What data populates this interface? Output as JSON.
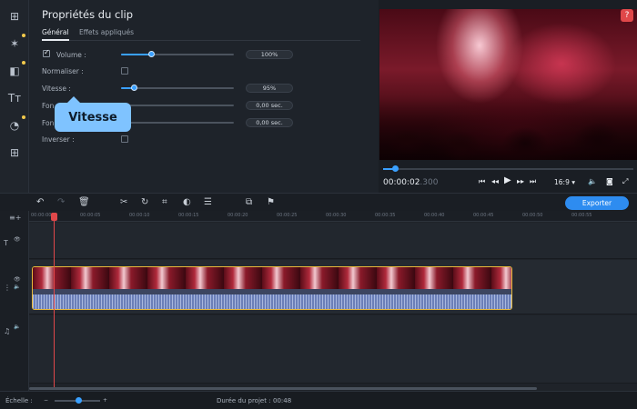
{
  "properties": {
    "title": "Propriétés du clip",
    "tabs": [
      {
        "label": "Général",
        "active": true
      },
      {
        "label": "Effets appliqués",
        "active": false
      }
    ],
    "rows": {
      "volume": {
        "label": "Volume :",
        "checked": true,
        "value": "100%",
        "level": 0.33
      },
      "normaliser": {
        "label": "Normaliser :",
        "checked": false
      },
      "vitesse": {
        "label": "Vitesse :",
        "value": "95%",
        "level": 0.1
      },
      "fondu_entree": {
        "label": "Fon",
        "value": "0,00 sec."
      },
      "fondu_sortie": {
        "label": "Fon",
        "value": "0,00 sec."
      },
      "inverser": {
        "label": "Inverser :",
        "checked": false
      }
    },
    "tooltip": "Vitesse"
  },
  "preview": {
    "timecode_main": "00:00:02",
    "timecode_ms": ".300",
    "aspect_ratio": "16:9 ▾",
    "help": "?"
  },
  "toolbar": {
    "export_label": "Exporter"
  },
  "timeline": {
    "ticks": [
      "00:00:00",
      "00:00:05",
      "00:00:10",
      "00:00:15",
      "00:00:20",
      "00:00:25",
      "00:00:30",
      "00:00:35",
      "00:00:40",
      "00:00:45",
      "00:00:50",
      "00:00:55"
    ]
  },
  "footer": {
    "scale_label": "Échelle :",
    "duration_label": "Durée du projet :",
    "duration_value": "00:48"
  },
  "colors": {
    "accent": "#3aa0ff",
    "export": "#2e8cf0",
    "playhead": "#e0484a",
    "clip_border": "#e8b93c"
  }
}
